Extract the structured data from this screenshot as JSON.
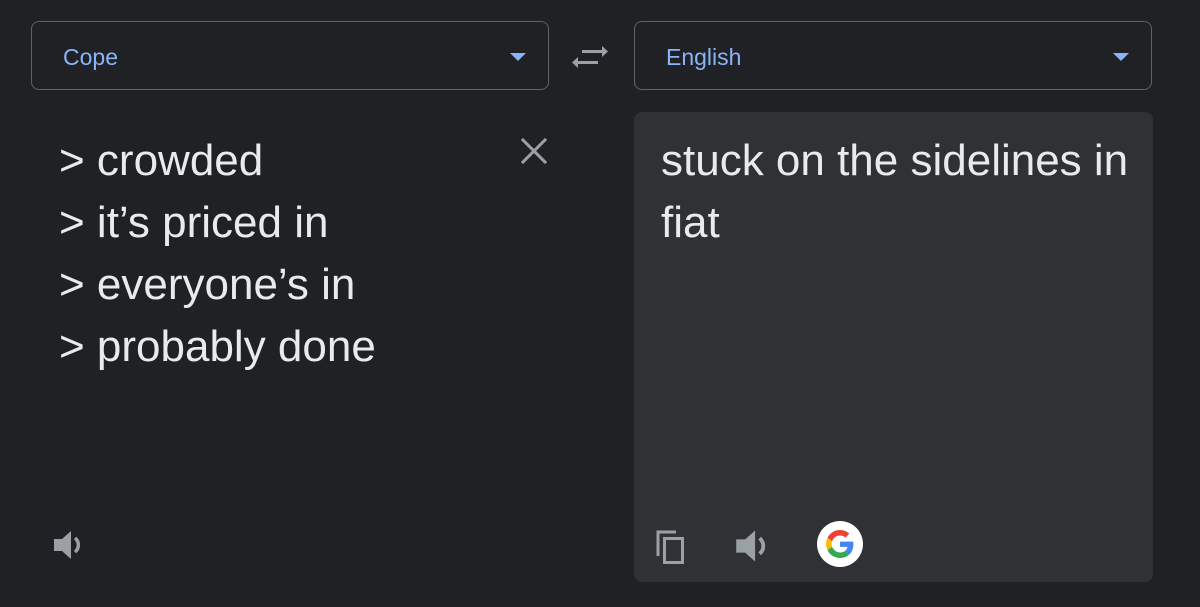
{
  "source_language": {
    "label": "Cope",
    "icon": "dropdown-arrow-icon"
  },
  "target_language": {
    "label": "English",
    "icon": "dropdown-arrow-icon"
  },
  "swap": {
    "icon": "swap-languages-icon"
  },
  "source": {
    "lines": [
      "> crowded",
      "> it’s priced in",
      "> everyone’s in",
      "> probably done"
    ],
    "clear_icon": "close-icon",
    "listen_icon": "speaker-icon"
  },
  "translation": {
    "text": "stuck on the sidelines in fiat",
    "copy_icon": "copy-icon",
    "listen_icon": "speaker-icon",
    "brand_icon": "google-logo-icon"
  },
  "colors": {
    "background": "#202124",
    "panel": "#303134",
    "accent": "#8ab4f8",
    "text": "#e8eaed",
    "icon": "#9aa0a6",
    "border": "#5f6368"
  }
}
